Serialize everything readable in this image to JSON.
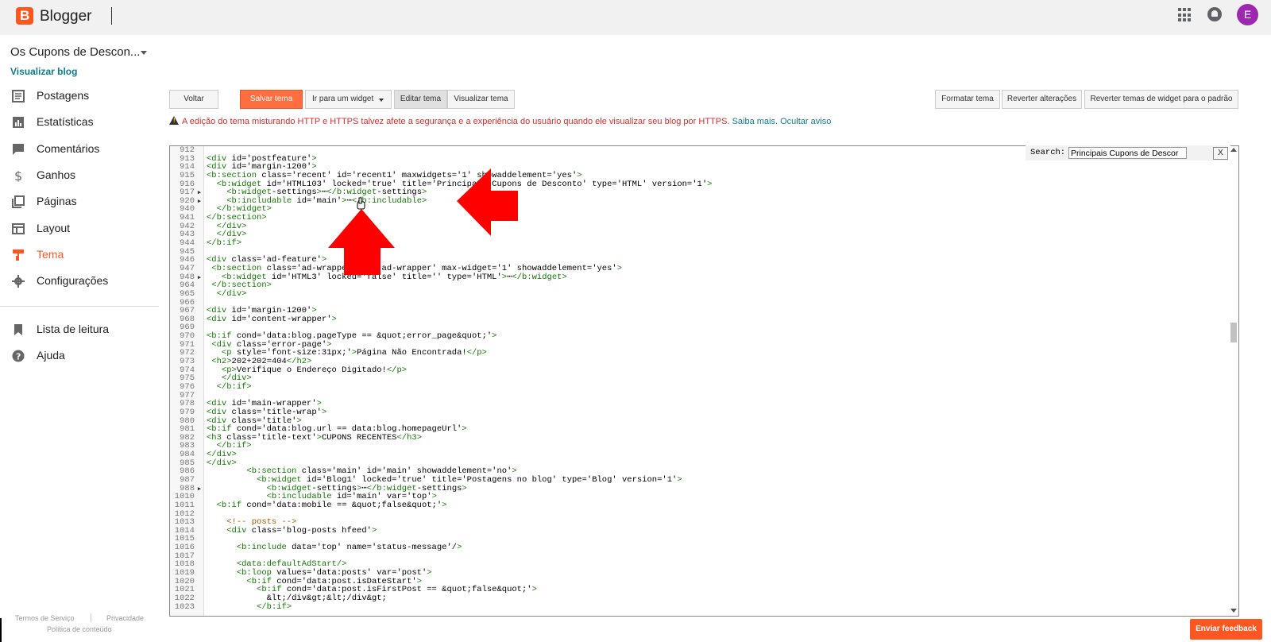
{
  "app": {
    "name": "Blogger",
    "logo_letter": "B",
    "avatar_letter": "E"
  },
  "blog": {
    "title": "Os Cupons de Descon...",
    "view_link": "Visualizar blog"
  },
  "sidebar": {
    "items": [
      {
        "label": "Postagens",
        "icon": "posts-icon"
      },
      {
        "label": "Estatísticas",
        "icon": "stats-icon"
      },
      {
        "label": "Comentários",
        "icon": "comments-icon"
      },
      {
        "label": "Ganhos",
        "icon": "dollar-icon"
      },
      {
        "label": "Páginas",
        "icon": "pages-icon"
      },
      {
        "label": "Layout",
        "icon": "layout-icon"
      },
      {
        "label": "Tema",
        "icon": "paint-roller-icon",
        "active": true
      },
      {
        "label": "Configurações",
        "icon": "gear-icon"
      }
    ],
    "secondary": [
      {
        "label": "Lista de leitura",
        "icon": "bookmark-icon"
      },
      {
        "label": "Ajuda",
        "icon": "help-icon"
      }
    ]
  },
  "toolbar": {
    "back": "Voltar",
    "save": "Salvar tema",
    "goto_widget": "Ir para um widget",
    "edit": "Editar tema",
    "preview": "Visualizar tema",
    "format": "Formatar tema",
    "revert": "Reverter alterações",
    "revert_widgets": "Reverter temas de widget para o padrão"
  },
  "warning": {
    "text": "A edição do tema misturando HTTP e HTTPS talvez afete a segurança e a experiência do usuário quando ele visualizar seu blog por HTTPS.",
    "learn_more": "Saiba mais.",
    "hide": "Ocultar aviso"
  },
  "search": {
    "label": "Search:",
    "value": "Principais Cupons de Descor",
    "close": "X"
  },
  "code": {
    "lines": [
      {
        "n": "912",
        "t": ""
      },
      {
        "n": "913",
        "t": "<div id='postfeature'>"
      },
      {
        "n": "914",
        "t": "<div id='margin-1200'>"
      },
      {
        "n": "915",
        "t": "<b:section class='recent' id='recent1' maxwidgets='1' showaddelement='yes'>"
      },
      {
        "n": "916",
        "t": "  <b:widget id='HTML103' locked='true' title='Principais Cupons de Desconto' type='HTML' version='1'>"
      },
      {
        "n": "917",
        "t": "    <b:widget-settings>⋯</b:widget-settings>",
        "fold": true
      },
      {
        "n": "920",
        "t": "    <b:includable id='main'>⋯</b:includable>",
        "fold": true
      },
      {
        "n": "940",
        "t": "  </b:widget>"
      },
      {
        "n": "941",
        "t": "</b:section>"
      },
      {
        "n": "942",
        "t": "  </div>"
      },
      {
        "n": "943",
        "t": "  </div>"
      },
      {
        "n": "944",
        "t": "</b:if>"
      },
      {
        "n": "945",
        "t": ""
      },
      {
        "n": "946",
        "t": "<div class='ad-feature'>"
      },
      {
        "n": "947",
        "t": " <b:section class='ad-wrapper' id='ad-wrapper' max-widget='1' showaddelement='yes'>"
      },
      {
        "n": "948",
        "t": "   <b:widget id='HTML3' locked='false' title='' type='HTML'>⋯</b:widget>",
        "fold": true
      },
      {
        "n": "964",
        "t": " </b:section>"
      },
      {
        "n": "965",
        "t": "  </div>"
      },
      {
        "n": "966",
        "t": ""
      },
      {
        "n": "967",
        "t": "<div id='margin-1200'>"
      },
      {
        "n": "968",
        "t": "<div id='content-wrapper'>"
      },
      {
        "n": "969",
        "t": ""
      },
      {
        "n": "970",
        "t": "<b:if cond='data:blog.pageType == &quot;error_page&quot;'>"
      },
      {
        "n": "971",
        "t": " <div class='error-page'>"
      },
      {
        "n": "972",
        "t": "   <p style='font-size:31px;'>Página Não Encontrada!</p>"
      },
      {
        "n": "973",
        "t": " <h2>202+202=404</h2>"
      },
      {
        "n": "974",
        "t": "   <p>Verifique o Endereço Digitado!</p>"
      },
      {
        "n": "975",
        "t": "   </div>"
      },
      {
        "n": "976",
        "t": "  </b:if>"
      },
      {
        "n": "977",
        "t": ""
      },
      {
        "n": "978",
        "t": "<div id='main-wrapper'>"
      },
      {
        "n": "979",
        "t": "<div class='title-wrap'>"
      },
      {
        "n": "980",
        "t": "<div class='title'>"
      },
      {
        "n": "981",
        "t": "<b:if cond='data:blog.url == data:blog.homepageUrl'>"
      },
      {
        "n": "982",
        "t": "<h3 class='title-text'>CUPONS RECENTES</h3>"
      },
      {
        "n": "983",
        "t": "  </b:if>"
      },
      {
        "n": "984",
        "t": "</div>"
      },
      {
        "n": "985",
        "t": "</div>"
      },
      {
        "n": "986",
        "t": "        <b:section class='main' id='main' showaddelement='no'>"
      },
      {
        "n": "987",
        "t": "          <b:widget id='Blog1' locked='true' title='Postagens no blog' type='Blog' version='1'>"
      },
      {
        "n": "988",
        "t": "            <b:widget-settings>⋯</b:widget-settings>",
        "fold": true
      },
      {
        "n": "1010",
        "t": "            <b:includable id='main' var='top'>"
      },
      {
        "n": "1011",
        "t": "  <b:if cond='data:mobile == &quot;false&quot;'>"
      },
      {
        "n": "1012",
        "t": ""
      },
      {
        "n": "1013",
        "t": "    <!-- posts -->"
      },
      {
        "n": "1014",
        "t": "    <div class='blog-posts hfeed'>"
      },
      {
        "n": "1015",
        "t": ""
      },
      {
        "n": "1016",
        "t": "      <b:include data='top' name='status-message'/>"
      },
      {
        "n": "1017",
        "t": ""
      },
      {
        "n": "1018",
        "t": "      <data:defaultAdStart/>"
      },
      {
        "n": "1019",
        "t": "      <b:loop values='data:posts' var='post'>"
      },
      {
        "n": "1020",
        "t": "        <b:if cond='data:post.isDateStart'>"
      },
      {
        "n": "1021",
        "t": "          <b:if cond='data:post.isFirstPost == &quot;false&quot;'>"
      },
      {
        "n": "1022",
        "t": "            &lt;/div&gt;&lt;/div&gt;"
      },
      {
        "n": "1023",
        "t": "          </b:if>"
      }
    ],
    "highlight": "PRINCIPAIS CUPONS DE DESCONTO"
  },
  "footer": {
    "terms": "Termos de Serviço",
    "privacy": "Privacidade",
    "content_policy": "Política de conteúdo",
    "feedback": "Enviar feedback"
  },
  "colors": {
    "accent": "#ff5722",
    "link": "#0f7c8e",
    "warning": "#d32f2f",
    "annotation": "#ff0000"
  }
}
